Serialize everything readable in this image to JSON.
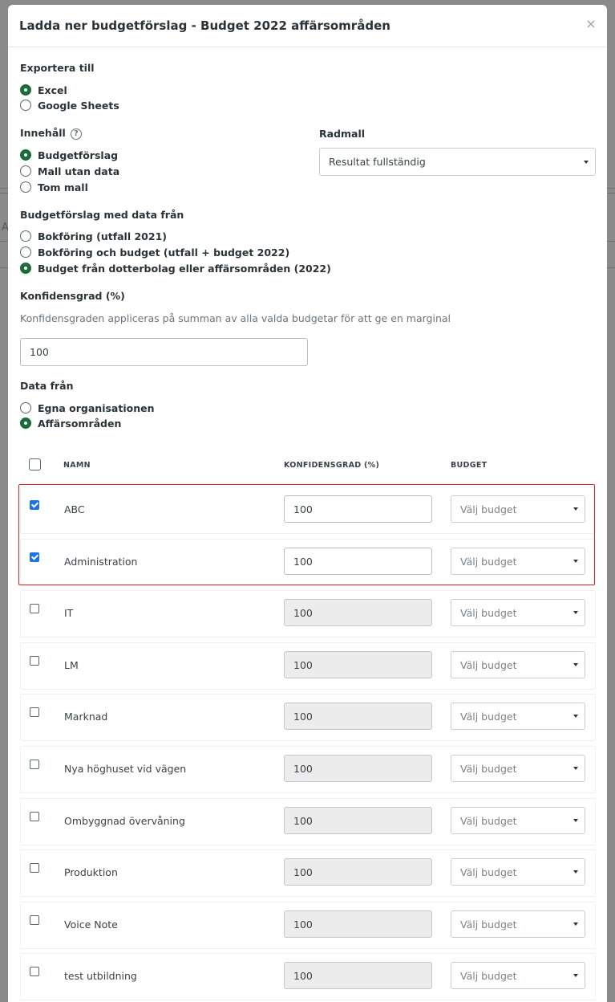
{
  "dialog": {
    "title": "Ladda ner budgetförslag - Budget 2022 affärsområden",
    "close_glyph": "×"
  },
  "export": {
    "label": "Exportera till",
    "options": [
      {
        "label": "Excel",
        "checked": true
      },
      {
        "label": "Google Sheets",
        "checked": false
      }
    ]
  },
  "content": {
    "label": "Innehåll",
    "help_glyph": "?",
    "options": [
      {
        "label": "Budgetförslag",
        "checked": true
      },
      {
        "label": "Mall utan data",
        "checked": false
      },
      {
        "label": "Tom mall",
        "checked": false
      }
    ]
  },
  "row_template": {
    "label": "Radmall",
    "selected": "Resultat fullständig"
  },
  "budget_data_source": {
    "label": "Budgetförslag med data från",
    "options": [
      {
        "label": "Bokföring (utfall 2021)",
        "checked": false
      },
      {
        "label": "Bokföring och budget (utfall + budget 2022)",
        "checked": false
      },
      {
        "label": "Budget från dotterbolag eller affärsområden (2022)",
        "checked": true
      }
    ]
  },
  "confidence": {
    "label": "Konfidensgrad (%)",
    "description": "Konfidensgraden appliceras på summan av alla valda budgetar för att ge en marginal",
    "value": "100"
  },
  "data_from": {
    "label": "Data från",
    "options": [
      {
        "label": "Egna organisationen",
        "checked": false
      },
      {
        "label": "Affärsområden",
        "checked": true
      }
    ]
  },
  "table": {
    "headers": {
      "name": "NAMN",
      "confidence": "KONFIDENSGRAD (%)",
      "budget": "BUDGET"
    },
    "rows": [
      {
        "name": "ABC",
        "checked": true,
        "confidence": "100",
        "budget": "Välj budget"
      },
      {
        "name": "Administration",
        "checked": true,
        "confidence": "100",
        "budget": "Välj budget"
      },
      {
        "name": "IT",
        "checked": false,
        "confidence": "100",
        "budget": "Välj budget"
      },
      {
        "name": "LM",
        "checked": false,
        "confidence": "100",
        "budget": "Välj budget"
      },
      {
        "name": "Marknad",
        "checked": false,
        "confidence": "100",
        "budget": "Välj budget"
      },
      {
        "name": "Nya höghuset vid vägen",
        "checked": false,
        "confidence": "100",
        "budget": "Välj budget"
      },
      {
        "name": "Ombyggnad övervåning",
        "checked": false,
        "confidence": "100",
        "budget": "Välj budget"
      },
      {
        "name": "Produktion",
        "checked": false,
        "confidence": "100",
        "budget": "Välj budget"
      },
      {
        "name": "Voice Note",
        "checked": false,
        "confidence": "100",
        "budget": "Välj budget"
      },
      {
        "name": "test utbildning",
        "checked": false,
        "confidence": "100",
        "budget": "Välj budget"
      }
    ]
  },
  "background": {
    "partial_letter": "A"
  },
  "colors": {
    "accent_green": "#1c6b3c",
    "checkbox_blue": "#1a73e8",
    "highlight_red": "#d0262b"
  }
}
